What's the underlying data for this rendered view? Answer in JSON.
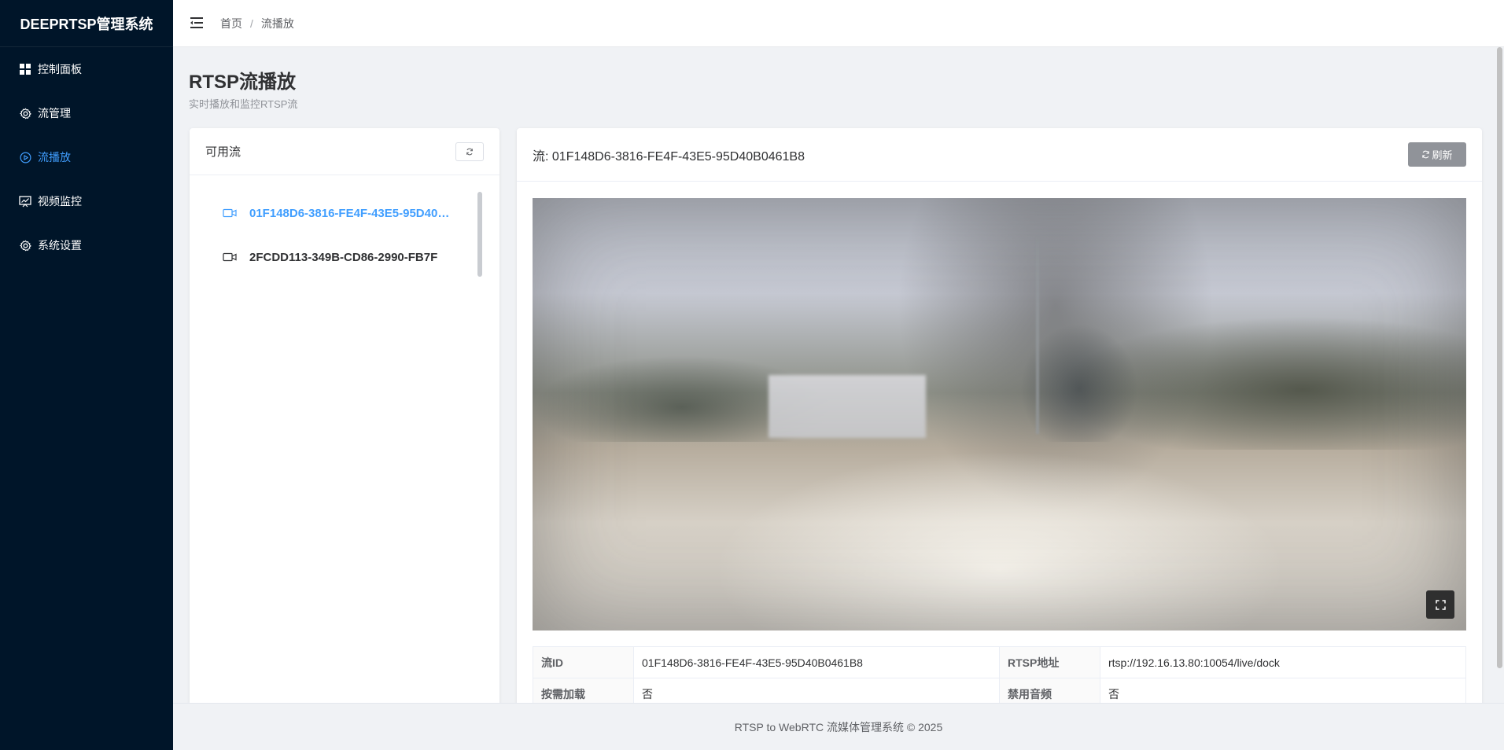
{
  "brand": "DEEPRTSP管理系统",
  "sidebar": {
    "items": [
      {
        "label": "控制面板",
        "icon": "dashboard-icon"
      },
      {
        "label": "流管理",
        "icon": "gear-icon"
      },
      {
        "label": "流播放",
        "icon": "play-circle-icon",
        "active": true
      },
      {
        "label": "视频监控",
        "icon": "monitor-chart-icon"
      },
      {
        "label": "系统设置",
        "icon": "gear-icon"
      }
    ]
  },
  "header": {
    "breadcrumb": [
      "首页",
      "流播放"
    ],
    "separator": "/"
  },
  "page": {
    "title": "RTSP流播放",
    "subtitle": "实时播放和监控RTSP流"
  },
  "streams_panel": {
    "title": "可用流",
    "items": [
      {
        "label": "01F148D6-3816-FE4F-43E5-95D40B0461B8",
        "active": true
      },
      {
        "label": "2FCDD113-349B-CD86-2990-FB7F"
      }
    ]
  },
  "player": {
    "title": "流: 01F148D6-3816-FE4F-43E5-95D40B0461B8",
    "refresh_label": "刷新"
  },
  "info": {
    "rows": [
      {
        "k1": "流ID",
        "v1": "01F148D6-3816-FE4F-43E5-95D40B0461B8",
        "k2": "RTSP地址",
        "v2": "rtsp://192.16.13.80:10054/live/dock"
      },
      {
        "k1": "按需加载",
        "v1": "否",
        "k2": "禁用音频",
        "v2": "否"
      }
    ]
  },
  "footer": "RTSP to WebRTC 流媒体管理系统 © 2025",
  "colors": {
    "sidebar_bg": "#001529",
    "accent": "#409eff",
    "refresh_button": "#909399"
  }
}
